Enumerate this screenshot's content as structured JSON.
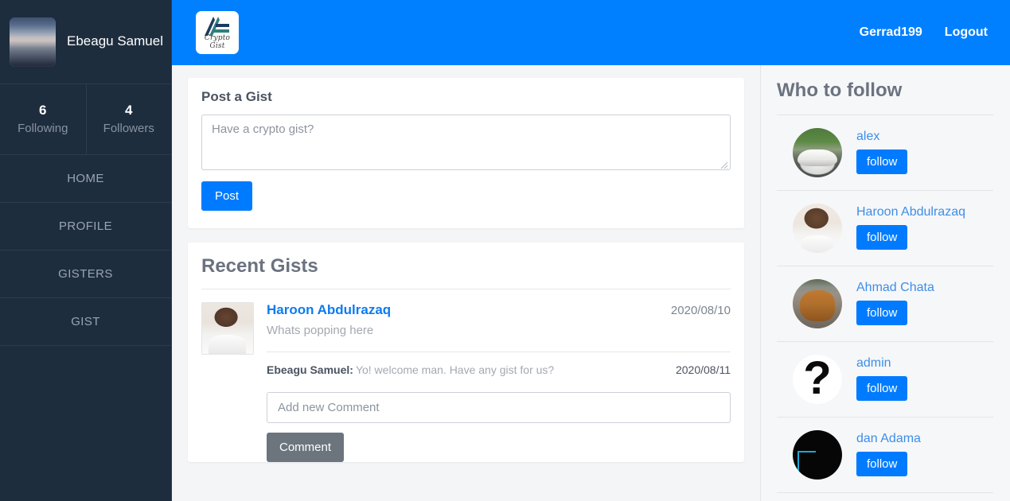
{
  "sidebar": {
    "profile_name": "Ebeagu Samuel",
    "avatar_name": "seascape-photo",
    "stats": [
      {
        "value": "6",
        "label": "Following"
      },
      {
        "value": "4",
        "label": "Followers"
      }
    ],
    "nav": [
      {
        "label": "HOME"
      },
      {
        "label": "PROFILE"
      },
      {
        "label": "GISTERS"
      },
      {
        "label": "GIST"
      }
    ]
  },
  "topbar": {
    "logo_text": "Crypto Gist",
    "username": "Gerrad199",
    "logout_label": "Logout",
    "background_color": "#0080ff"
  },
  "post_card": {
    "title": "Post a Gist",
    "textarea_value": "",
    "textarea_placeholder": "Have a crypto gist?",
    "post_label": "Post",
    "post_color": "#007bff"
  },
  "recent": {
    "title": "Recent Gists",
    "gists": [
      {
        "author": "Haroon Abdulrazaq",
        "date": "2020/08/10",
        "text": "Whats popping here",
        "avatar_name": "haroon-avatar",
        "comments": [
          {
            "author": "Ebeagu Samuel",
            "separator": ":",
            "text": "Yo! welcome man. Have any gist for us?",
            "date": "2020/08/11"
          }
        ],
        "comment_input_value": "",
        "comment_input_placeholder": "Add new Comment",
        "comment_button_label": "Comment",
        "comment_button_color": "#6c757d"
      }
    ]
  },
  "who_to_follow": {
    "title": "Who to follow",
    "follow_label": "follow",
    "follow_color": "#007bff",
    "people": [
      {
        "name": "alex",
        "avatar_name": "car-photo-avatar"
      },
      {
        "name": "Haroon Abdulrazaq",
        "avatar_name": "haroon-photo-avatar"
      },
      {
        "name": "Ahmad Chata",
        "avatar_name": "dog-photo-avatar"
      },
      {
        "name": "admin",
        "avatar_name": "question-mark-avatar"
      },
      {
        "name": "dan Adama",
        "avatar_name": "dark-photo-avatar"
      }
    ]
  }
}
